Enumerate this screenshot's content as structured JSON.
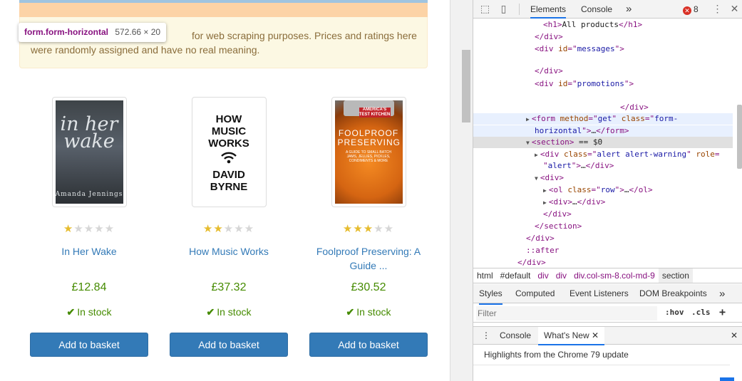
{
  "tooltip": {
    "selector": "form.form-horizontal",
    "dims": "572.66 × 20"
  },
  "alert": {
    "line1": "for web scraping purposes. Prices and ratings here",
    "line2": "were randomly assigned and have no real meaning."
  },
  "products": [
    {
      "title": "In Her Wake",
      "price": "£12.84",
      "rating": 1,
      "stock": "In stock",
      "button": "Add to basket",
      "cover": {
        "text": "in her wake",
        "author": "Amanda Jennings"
      }
    },
    {
      "title": "How Music Works",
      "price": "£37.32",
      "rating": 2,
      "stock": "In stock",
      "button": "Add to basket",
      "cover": {
        "text": "HOW MUSIC WORKS",
        "author": "DAVID BYRNE"
      }
    },
    {
      "title": "Foolproof Preserving: A Guide ...",
      "price": "£30.52",
      "rating": 3,
      "stock": "In stock",
      "button": "Add to basket",
      "cover": {
        "badge": "AMERICA'S TEST KITCHEN",
        "text": "FOOLPROOF PRESERVING",
        "sub": "A GUIDE TO SMALL BATCH JAMS, JELLIES, PICKLES, CONDIMENTS & MORE"
      }
    }
  ],
  "devtools": {
    "tabs": [
      "Elements",
      "Console"
    ],
    "more": "»",
    "errors": "8",
    "dom": [
      {
        "parts": [
          [
            "tag",
            "<h1>"
          ],
          [
            "txt",
            "All products"
          ],
          [
            "tag",
            "</h1>"
          ]
        ]
      },
      {
        "parts": [
          [
            "tag",
            "</div>"
          ]
        ]
      },
      {
        "parts": [
          [
            "tag",
            "<div "
          ],
          [
            "attr",
            "id"
          ],
          [
            "tag",
            "=\""
          ],
          [
            "val",
            "messages"
          ],
          [
            "tag",
            "\">"
          ]
        ]
      },
      {
        "parts": []
      },
      {
        "parts": [
          [
            "tag",
            "</div>"
          ]
        ]
      },
      {
        "parts": [
          [
            "tag",
            "<div "
          ],
          [
            "attr",
            "id"
          ],
          [
            "tag",
            "=\""
          ],
          [
            "val",
            "promotions"
          ],
          [
            "tag",
            "\">"
          ]
        ]
      },
      {
        "parts": []
      },
      {
        "parts": [
          [
            "tag",
            "</div>"
          ]
        ]
      },
      {
        "parts": [
          [
            "tri",
            "▶"
          ],
          [
            "tag",
            "<form "
          ],
          [
            "attr",
            "method"
          ],
          [
            "tag",
            "=\""
          ],
          [
            "val",
            "get"
          ],
          [
            "tag",
            "\" "
          ],
          [
            "attr",
            "class"
          ],
          [
            "tag",
            "=\""
          ],
          [
            "val",
            "form-"
          ]
        ]
      },
      {
        "parts": [
          [
            "val",
            "horizontal"
          ],
          [
            "tag",
            "\">"
          ],
          [
            "txt",
            "…"
          ],
          [
            "tag",
            "</form>"
          ]
        ]
      },
      {
        "parts": [
          [
            "tri",
            "▼"
          ],
          [
            "tag",
            "<section>"
          ],
          [
            "txt",
            " == "
          ],
          [
            "txt",
            "$0"
          ]
        ]
      },
      {
        "parts": [
          [
            "tri",
            "▶"
          ],
          [
            "tag",
            "<div "
          ],
          [
            "attr",
            "class"
          ],
          [
            "tag",
            "=\""
          ],
          [
            "val",
            "alert alert-warning"
          ],
          [
            "tag",
            "\" "
          ],
          [
            "attr",
            "role"
          ],
          [
            "tag",
            "="
          ]
        ]
      },
      {
        "parts": [
          [
            "tag",
            "\""
          ],
          [
            "val",
            "alert"
          ],
          [
            "tag",
            "\">"
          ],
          [
            "txt",
            "…"
          ],
          [
            "tag",
            "</div>"
          ]
        ]
      },
      {
        "parts": [
          [
            "tri",
            "▼"
          ],
          [
            "tag",
            "<div>"
          ]
        ]
      },
      {
        "parts": [
          [
            "tri",
            "▶"
          ],
          [
            "tag",
            "<ol "
          ],
          [
            "attr",
            "class"
          ],
          [
            "tag",
            "=\""
          ],
          [
            "val",
            "row"
          ],
          [
            "tag",
            "\">"
          ],
          [
            "txt",
            "…"
          ],
          [
            "tag",
            "</ol>"
          ]
        ]
      },
      {
        "parts": [
          [
            "tri",
            "▶"
          ],
          [
            "tag",
            "<div>"
          ],
          [
            "txt",
            "…"
          ],
          [
            "tag",
            "</div>"
          ]
        ]
      },
      {
        "parts": [
          [
            "tag",
            "</div>"
          ]
        ]
      },
      {
        "parts": [
          [
            "tag",
            "</section>"
          ]
        ]
      },
      {
        "parts": [
          [
            "tag",
            "</div>"
          ]
        ]
      },
      {
        "parts": [
          [
            "tag",
            "::after"
          ]
        ]
      },
      {
        "parts": [
          [
            "tag",
            "</div>"
          ]
        ]
      }
    ],
    "breadcrumbs": [
      "html",
      "#default",
      "div",
      "div",
      "div.col-sm-8.col-md-9",
      "section"
    ],
    "subtabs": [
      "Styles",
      "Computed",
      "Event Listeners",
      "DOM Breakpoints",
      "»"
    ],
    "filter": {
      "placeholder": "Filter",
      "hov": ":hov",
      "cls": ".cls",
      "plus": "+"
    },
    "drawer": {
      "tabs": [
        "Console",
        "What's New"
      ],
      "headline": "Highlights from the Chrome 79 update"
    }
  }
}
